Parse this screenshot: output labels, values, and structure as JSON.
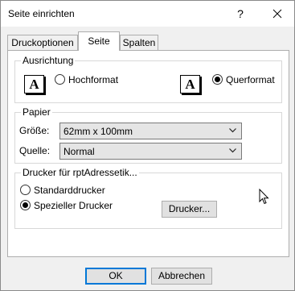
{
  "window": {
    "title": "Seite einrichten",
    "help_glyph": "?"
  },
  "tabs": [
    {
      "label": "Druckoptionen",
      "active": false
    },
    {
      "label": "Seite",
      "active": true
    },
    {
      "label": "Spalten",
      "active": false
    }
  ],
  "orientation": {
    "group_label": "Ausrichtung",
    "portrait_label": "Hochformat",
    "landscape_label": "Querformat",
    "icon_letter": "A",
    "selected": "Querformat"
  },
  "paper": {
    "group_label": "Papier",
    "size_label": "Größe:",
    "size_value": "62mm x 100mm",
    "source_label": "Quelle:",
    "source_value": "Normal"
  },
  "printer": {
    "group_label": "Drucker für rptAdressetik...",
    "default_label": "Standarddrucker",
    "specific_label": "Spezieller Drucker",
    "selected": "Spezieller Drucker",
    "printer_button_label": "Drucker..."
  },
  "footer": {
    "ok_label": "OK",
    "cancel_label": "Abbrechen"
  },
  "colors": {
    "dialog_bg": "#f0f0f0",
    "panel_bg": "#ffffff",
    "accent": "#0078d7"
  }
}
